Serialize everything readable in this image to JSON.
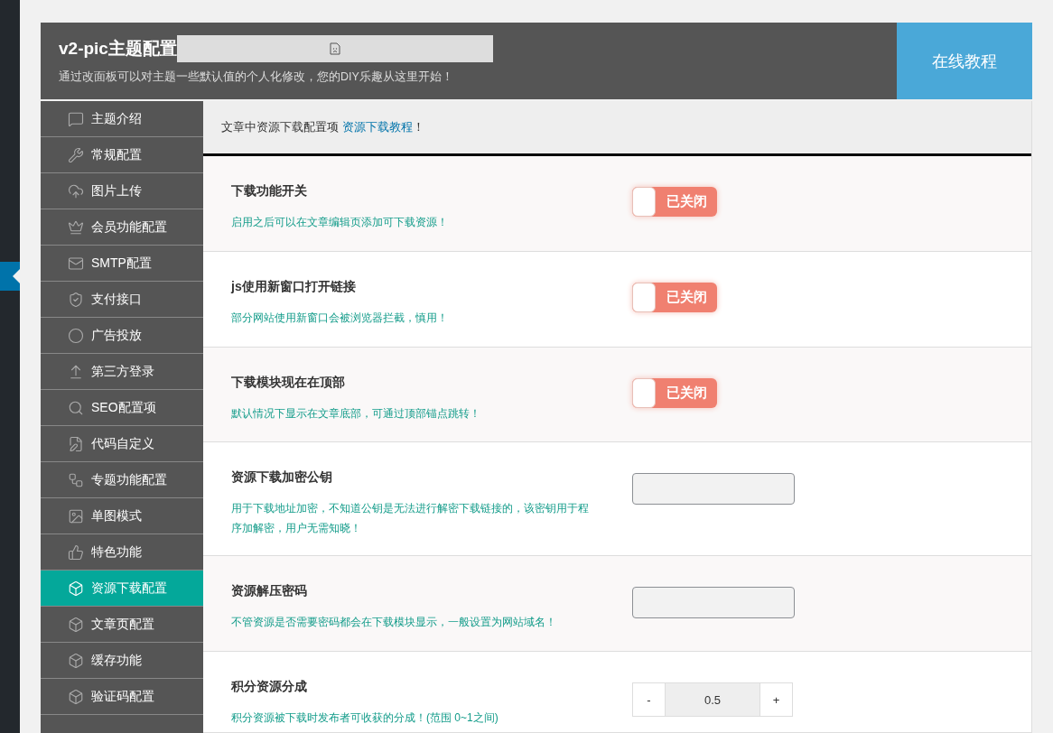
{
  "header": {
    "title": "v2-pic主题配置",
    "subtitle": "通过改面板可以对主题一些默认值的个人化修改，您的DIY乐趣从这里开始！",
    "tutorial_button": "在线教程"
  },
  "sidebar": {
    "items": [
      {
        "label": "主题介绍",
        "selected": false
      },
      {
        "label": "常规配置",
        "selected": false
      },
      {
        "label": "图片上传",
        "selected": false
      },
      {
        "label": "会员功能配置",
        "selected": false
      },
      {
        "label": "SMTP配置",
        "selected": false
      },
      {
        "label": "支付接口",
        "selected": false
      },
      {
        "label": "广告投放",
        "selected": false
      },
      {
        "label": "第三方登录",
        "selected": false
      },
      {
        "label": "SEO配置项",
        "selected": false
      },
      {
        "label": "代码自定义",
        "selected": false
      },
      {
        "label": "专题功能配置",
        "selected": false
      },
      {
        "label": "单图模式",
        "selected": false
      },
      {
        "label": "特色功能",
        "selected": false
      },
      {
        "label": "资源下载配置",
        "selected": true
      },
      {
        "label": "文章页配置",
        "selected": false
      },
      {
        "label": "缓存功能",
        "selected": false
      },
      {
        "label": "验证码配置",
        "selected": false
      }
    ]
  },
  "intro": {
    "text": "文章中资源下载配置项",
    "link": "资源下载教程",
    "suffix": "！"
  },
  "settings": [
    {
      "kind": "toggle",
      "title": "下载功能开关",
      "description": "启用之后可以在文章编辑页添加可下载资源！",
      "on": false,
      "state_label": "已关闭"
    },
    {
      "kind": "toggle",
      "title": "js使用新窗口打开链接",
      "description": "部分网站使用新窗口会被浏览器拦截，慎用！",
      "on": false,
      "state_label": "已关闭"
    },
    {
      "kind": "toggle",
      "title": "下载模块现在在顶部",
      "description": "默认情况下显示在文章底部，可通过顶部锚点跳转！",
      "on": false,
      "state_label": "已关闭"
    },
    {
      "kind": "text",
      "title": "资源下载加密公钥",
      "description": "用于下载地址加密，不知道公钥是无法进行解密下载链接的，该密钥用于程序加解密，用户无需知晓！"
    },
    {
      "kind": "text",
      "title": "资源解压密码",
      "description": "不管资源是否需要密码都会在下载模块显示，一般设置为网站域名！"
    },
    {
      "kind": "number",
      "title": "积分资源分成",
      "description": "积分资源被下载时发布者可收获的分成！(范围 0~1之间)",
      "value": "0.5",
      "minus": "-",
      "plus": "+"
    }
  ]
}
